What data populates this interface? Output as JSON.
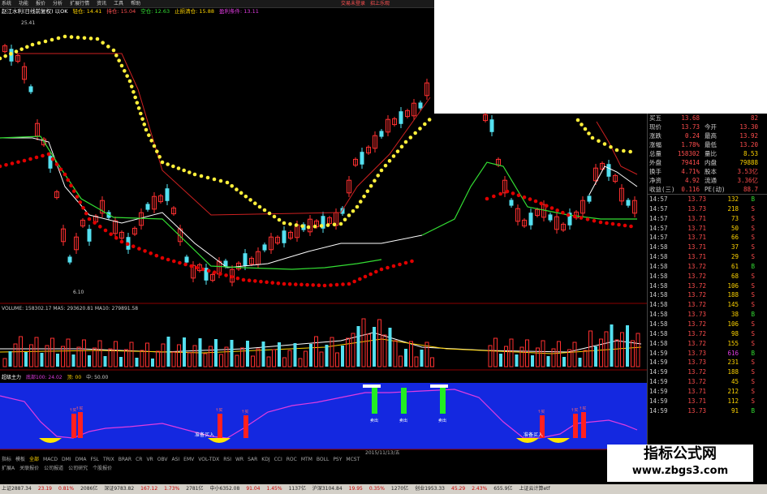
{
  "menu": {
    "items": [
      "系统",
      "功能",
      "报价",
      "分析",
      "扩展行情",
      "资讯",
      "工具",
      "帮助"
    ],
    "window_controls": [
      "交易未登录",
      "招上乐观"
    ]
  },
  "info_bar": {
    "stock": "赵江水利(日线前复权) 以OK",
    "fields": [
      "轻仓: 14.41",
      "持仓: 15.04",
      "空仓: 12.63",
      "止损清仓: 15.88",
      "盈利条件: 13.11"
    ]
  },
  "price_chart": {
    "high_label": "25.41",
    "low_label": "6.10"
  },
  "quote": {
    "top_rows": [
      {
        "l": "买五",
        "v1": "13.68",
        "l2": "",
        "v2": "82"
      },
      {
        "l": "现价",
        "v1": "13.73",
        "l2": "今开",
        "v2": "13.30"
      },
      {
        "l": "涨跌",
        "v1": "0.24",
        "l2": "最高",
        "v2": "13.92"
      },
      {
        "l": "涨幅",
        "v1": "1.78%",
        "l2": "最低",
        "v2": "13.20"
      },
      {
        "l": "总量",
        "v1": "158302",
        "l2": "量比",
        "v2": "8.53"
      },
      {
        "l": "外盘",
        "v1": "79414",
        "l2": "内盘",
        "v2": "79888"
      },
      {
        "l": "换手",
        "v1": "4.71%",
        "l2": "股本",
        "v2": "3.53亿"
      },
      {
        "l": "净资",
        "v1": "4.92",
        "l2": "流通",
        "v2": "3.36亿"
      },
      {
        "l": "收益(三)",
        "v1": "0.116",
        "l2": "PE(动)",
        "v2": "88.7"
      }
    ],
    "ticks": [
      {
        "t": "14:57",
        "p": "13.73",
        "vol": "132",
        "bs": "B"
      },
      {
        "t": "14:57",
        "p": "13.73",
        "vol": "218",
        "bs": "S"
      },
      {
        "t": "14:57",
        "p": "13.71",
        "vol": "73",
        "bs": "S"
      },
      {
        "t": "14:57",
        "p": "13.71",
        "vol": "50",
        "bs": "S"
      },
      {
        "t": "14:57",
        "p": "13.71",
        "vol": "66",
        "bs": "S"
      },
      {
        "t": "14:58",
        "p": "13.71",
        "vol": "37",
        "bs": "S"
      },
      {
        "t": "14:58",
        "p": "13.71",
        "vol": "29",
        "bs": "S"
      },
      {
        "t": "14:58",
        "p": "13.72",
        "vol": "61",
        "bs": "B"
      },
      {
        "t": "14:58",
        "p": "13.72",
        "vol": "68",
        "bs": "S"
      },
      {
        "t": "14:58",
        "p": "13.72",
        "vol": "106",
        "bs": "S"
      },
      {
        "t": "14:58",
        "p": "13.72",
        "vol": "188",
        "bs": "S"
      },
      {
        "t": "14:58",
        "p": "13.72",
        "vol": "145",
        "bs": "S"
      },
      {
        "t": "14:58",
        "p": "13.73",
        "vol": "38",
        "bs": "B"
      },
      {
        "t": "14:58",
        "p": "13.72",
        "vol": "106",
        "bs": "S"
      },
      {
        "t": "14:58",
        "p": "13.72",
        "vol": "98",
        "bs": "S"
      },
      {
        "t": "14:58",
        "p": "13.72",
        "vol": "155",
        "bs": "S"
      },
      {
        "t": "14:59",
        "p": "13.73",
        "vol": "616",
        "bs": "B",
        "mag": true
      },
      {
        "t": "14:59",
        "p": "13.73",
        "vol": "231",
        "bs": "S"
      },
      {
        "t": "14:59",
        "p": "13.72",
        "vol": "188",
        "bs": "S"
      },
      {
        "t": "14:59",
        "p": "13.72",
        "vol": "45",
        "bs": "S"
      },
      {
        "t": "14:59",
        "p": "13.71",
        "vol": "212",
        "bs": "S"
      },
      {
        "t": "14:59",
        "p": "13.71",
        "vol": "112",
        "bs": "S"
      },
      {
        "t": "14:59",
        "p": "13.73",
        "vol": "91",
        "bs": "B"
      }
    ]
  },
  "volume": {
    "label": "VOLUME: 158302.17",
    "ma5": "MA5: 293620.81",
    "ma10": "MA10: 279891.58"
  },
  "indicator": {
    "name": "超级主力",
    "fields": [
      "底部100: 24.02",
      "顶: 00",
      "中: 50.00"
    ],
    "buy_label": "准备买入",
    "sell_label": "卖出",
    "date": "2015/11/13/五"
  },
  "tabs": [
    "指标",
    "模板",
    "全部",
    "MACD",
    "DMI",
    "DMA",
    "FSL",
    "TRIX",
    "BRAR",
    "CR",
    "VR",
    "OBV",
    "ASI",
    "EMV",
    "VOL-TDX",
    "RSI",
    "WR",
    "SAR",
    "KDJ",
    "CCI",
    "ROC",
    "MTM",
    "BOLL",
    "PSY",
    "MCST"
  ],
  "tabs2": [
    "扩展A",
    "关联报价",
    "公司报道",
    "公司研究",
    "个股报价"
  ],
  "status": [
    {
      "text": "上证2887.34",
      "cls": ""
    },
    {
      "text": "23.19",
      "cls": "red"
    },
    {
      "text": "0.81%",
      "cls": "red"
    },
    {
      "text": "2086亿",
      "cls": ""
    },
    {
      "text": "深证9783.82",
      "cls": ""
    },
    {
      "text": "167.12",
      "cls": "red"
    },
    {
      "text": "1.73%",
      "cls": "red"
    },
    {
      "text": "2781亿",
      "cls": ""
    },
    {
      "text": "中小6352.08",
      "cls": ""
    },
    {
      "text": "91.04",
      "cls": "red"
    },
    {
      "text": "1.45%",
      "cls": "red"
    },
    {
      "text": "1137亿",
      "cls": ""
    },
    {
      "text": "沪深3104.84",
      "cls": ""
    },
    {
      "text": "19.95",
      "cls": "red"
    },
    {
      "text": "0.35%",
      "cls": "red"
    },
    {
      "text": "1270亿",
      "cls": ""
    },
    {
      "text": "创业1953.33",
      "cls": ""
    },
    {
      "text": "45.29",
      "cls": "red"
    },
    {
      "text": "2.43%",
      "cls": "red"
    },
    {
      "text": "655.9亿",
      "cls": ""
    },
    {
      "text": "上证云计算etf",
      "cls": ""
    }
  ],
  "watermark": {
    "line1": "指标公式网",
    "line2": "www.zbgs3.com"
  },
  "colors": {
    "up": "#ff3030",
    "down": "#54e0f0",
    "yellow_dots": "#ffef3a",
    "red_dots": "#e00000",
    "indicator_bg": "#1428e0"
  }
}
